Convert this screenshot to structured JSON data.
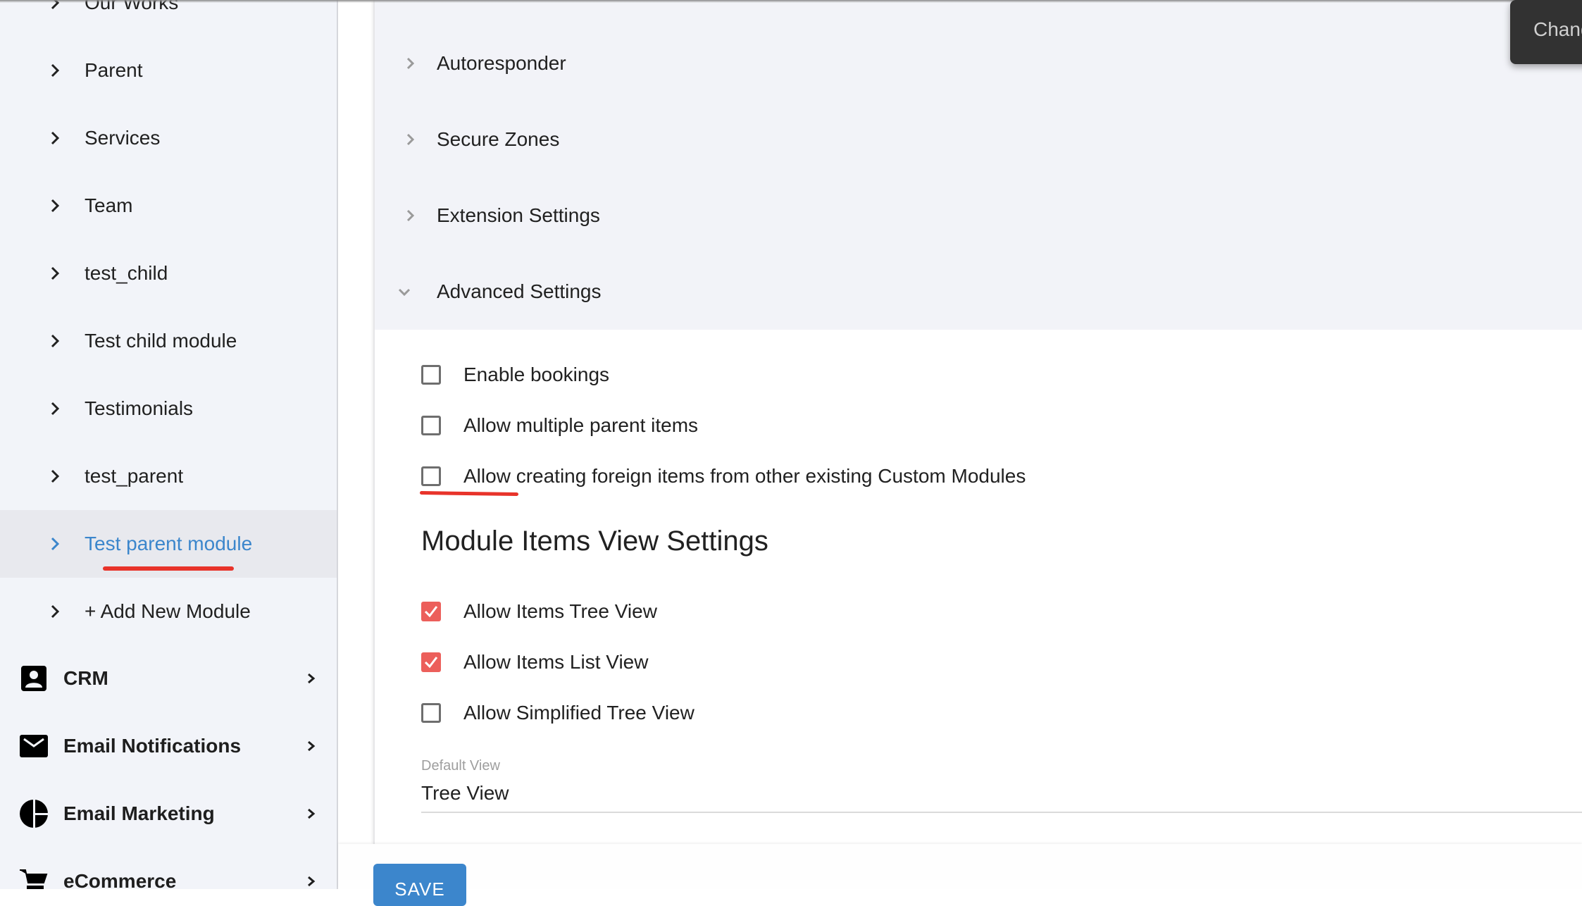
{
  "sidebar": {
    "sub_items": [
      {
        "label": "Our Works",
        "active": false
      },
      {
        "label": "Parent",
        "active": false
      },
      {
        "label": "Services",
        "active": false
      },
      {
        "label": "Team",
        "active": false
      },
      {
        "label": "test_child",
        "active": false
      },
      {
        "label": "Test child module",
        "active": false
      },
      {
        "label": "Testimonials",
        "active": false
      },
      {
        "label": "test_parent",
        "active": false
      },
      {
        "label": "Test parent module",
        "active": true
      },
      {
        "label": "+ Add New Module",
        "active": false
      }
    ],
    "main_items": [
      {
        "label": "CRM",
        "icon": "contact-card-icon"
      },
      {
        "label": "Email Notifications",
        "icon": "envelope-icon"
      },
      {
        "label": "Email Marketing",
        "icon": "pie-chart-icon"
      },
      {
        "label": "eCommerce",
        "icon": "cart-icon"
      }
    ]
  },
  "accordion": [
    {
      "label": "Autoresponder",
      "expanded": false
    },
    {
      "label": "Secure Zones",
      "expanded": false
    },
    {
      "label": "Extension Settings",
      "expanded": false
    },
    {
      "label": "Advanced Settings",
      "expanded": true
    }
  ],
  "advanced": {
    "checkboxes": [
      {
        "label": "Enable bookings",
        "checked": false
      },
      {
        "label": "Allow multiple parent items",
        "checked": false
      },
      {
        "label": "Allow creating foreign items from other existing Custom Modules",
        "checked": false
      }
    ],
    "view_settings_title": "Module Items View Settings",
    "view_checkboxes": [
      {
        "label": "Allow Items Tree View",
        "checked": true
      },
      {
        "label": "Allow Items List View",
        "checked": true
      },
      {
        "label": "Allow Simplified Tree View",
        "checked": false
      }
    ],
    "default_view": {
      "label": "Default View",
      "value": "Tree View"
    }
  },
  "footer": {
    "save_label": "SAVE"
  },
  "toast": {
    "text": "Changes saved"
  },
  "colors": {
    "accent_blue": "#3c86cc",
    "checkbox_red": "#ec5f5b",
    "annotation_red": "#e8332a"
  }
}
